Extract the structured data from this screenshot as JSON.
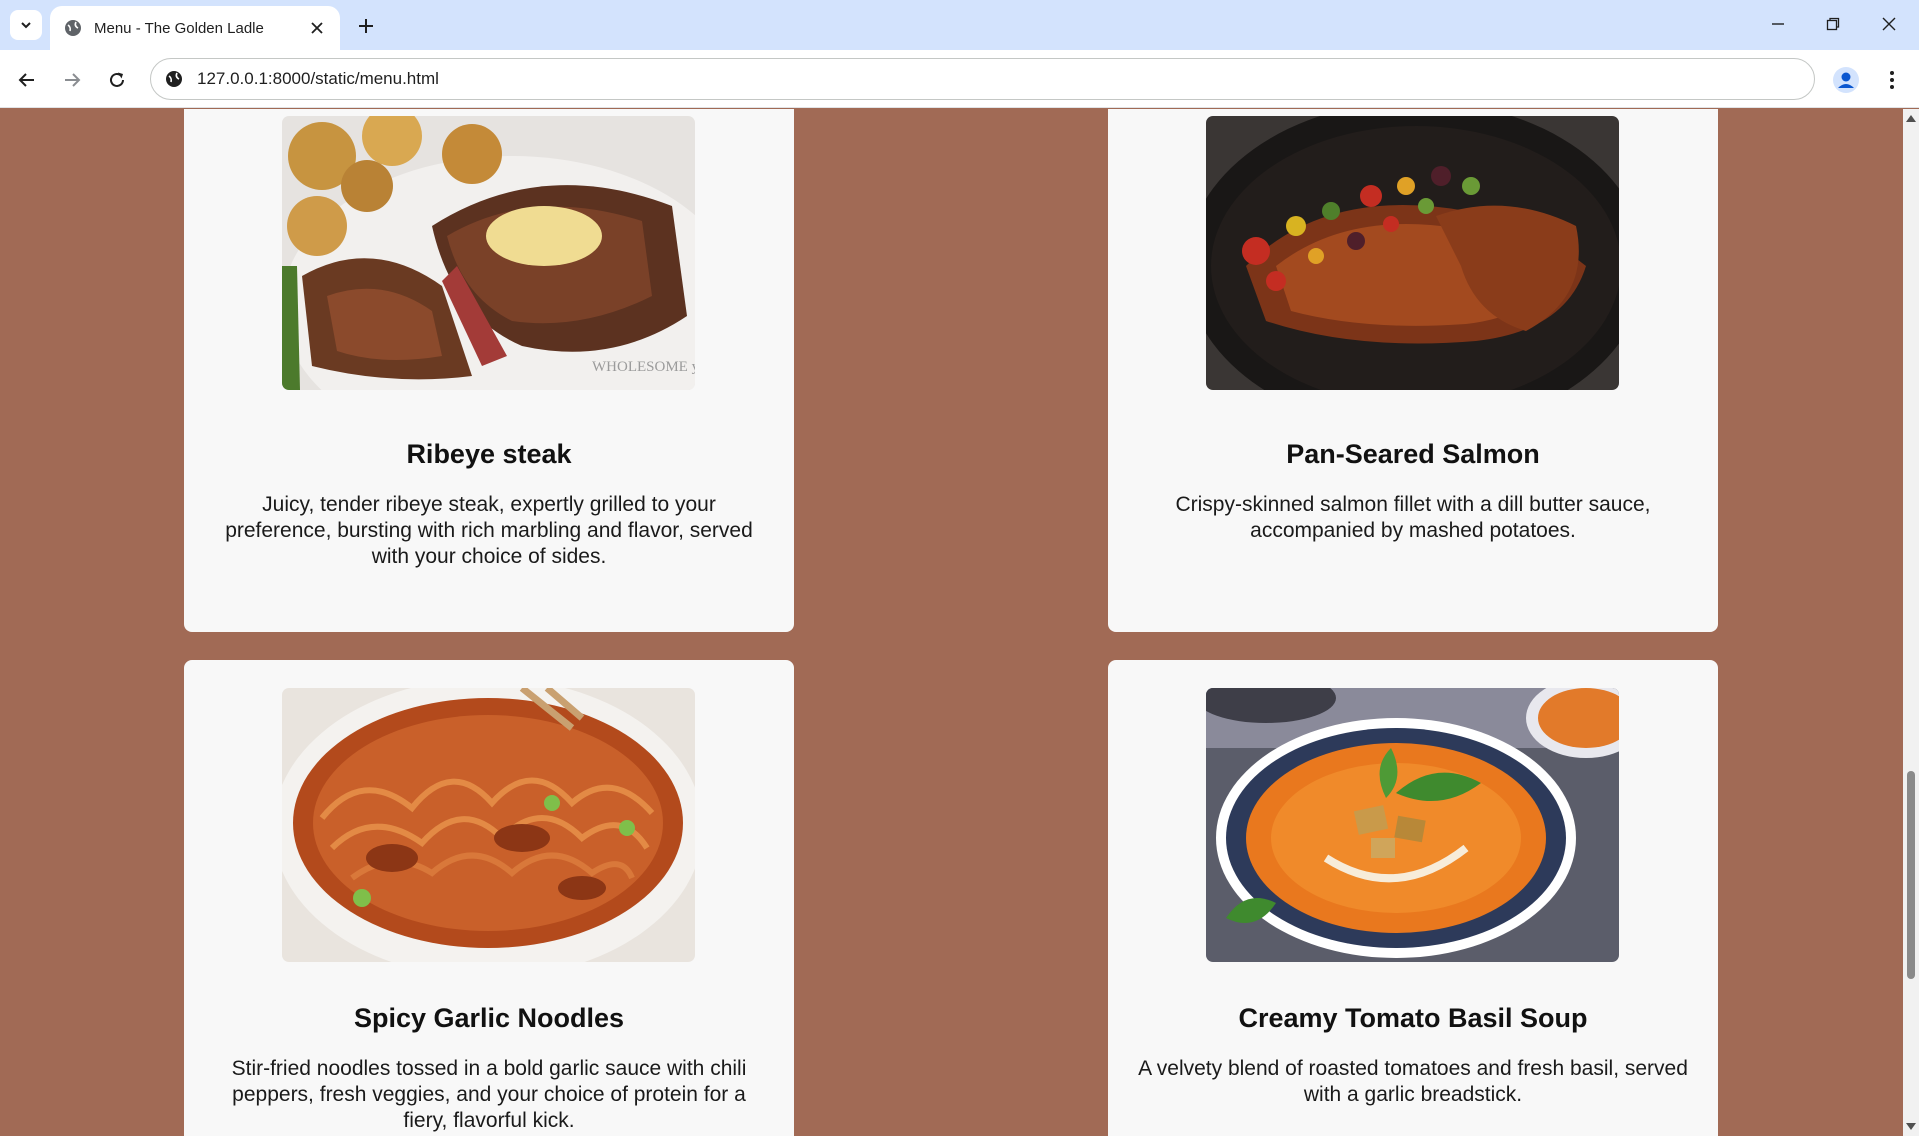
{
  "browser": {
    "tab_title": "Menu - The Golden Ladle",
    "url": "127.0.0.1:8000/static/menu.html"
  },
  "menu": {
    "items": [
      {
        "name": "Ribeye steak",
        "description": "Juicy, tender ribeye steak, expertly grilled to your preference, bursting with rich marbling and flavor, served with your choice of sides.",
        "image_watermark": "WHOLESOME yum"
      },
      {
        "name": "Pan-Seared Salmon",
        "description": "Crispy-skinned salmon fillet with a dill butter sauce, accompanied by mashed potatoes."
      },
      {
        "name": "Spicy Garlic Noodles",
        "description": "Stir-fried noodles tossed in a bold garlic sauce with chili peppers, fresh veggies, and your choice of protein for a fiery, flavorful kick."
      },
      {
        "name": "Creamy Tomato Basil Soup",
        "description": "A velvety blend of roasted tomatoes and fresh basil, served with a garlic breadstick."
      }
    ]
  },
  "colors": {
    "page_background": "#a16a55",
    "card_background": "#f8f8f8",
    "tabbar_background": "#d3e3fd"
  },
  "icons": [
    "tab-list-icon",
    "globe-icon",
    "close-icon",
    "plus-icon",
    "minimize-icon",
    "restore-icon",
    "window-close-icon",
    "back-arrow-icon",
    "forward-arrow-icon",
    "reload-icon",
    "site-info-icon",
    "profile-icon",
    "kebab-menu-icon"
  ]
}
